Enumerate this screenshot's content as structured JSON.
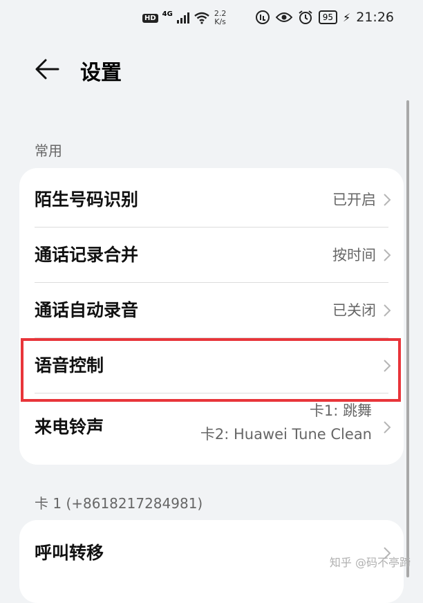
{
  "status_bar": {
    "hd": "HD",
    "signal": "4G",
    "net_speed_value": "2.2",
    "net_speed_unit": "K/s",
    "battery": "95",
    "time": "21:26"
  },
  "header": {
    "title": "设置"
  },
  "sections": [
    {
      "label": "常用",
      "rows": [
        {
          "label": "陌生号码识别",
          "value": "已开启"
        },
        {
          "label": "通话记录合并",
          "value": "按时间"
        },
        {
          "label": "通话自动录音",
          "value": "已关闭"
        },
        {
          "label": "语音控制",
          "value": ""
        },
        {
          "label": "来电铃声",
          "value_line1": "卡1: 跳舞",
          "value_line2": "卡2: Huawei Tune Clean"
        }
      ]
    },
    {
      "label": "卡 1 (+8618217284981)",
      "rows": [
        {
          "label": "呼叫转移",
          "value": ""
        }
      ]
    }
  ],
  "watermark": "知乎 @码不亭蹄",
  "colors": {
    "background": "#f1f3f5",
    "card": "#ffffff",
    "highlight": "#e8353a"
  }
}
